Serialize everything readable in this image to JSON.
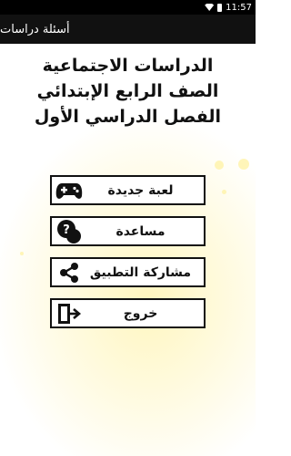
{
  "status_bar": {
    "time": "11:57",
    "icons": [
      "wifi-icon",
      "battery-icon"
    ]
  },
  "app_bar": {
    "title": "أسئلة دراسات"
  },
  "header": {
    "line1": "الدراسات الاجتماعية",
    "line2": "الصف الرابع الإبتدائي",
    "line3": "الفصل الدراسي الأول"
  },
  "menu": [
    {
      "label": "لعبة جديدة",
      "icon": "gamepad-icon"
    },
    {
      "label": "مساعدة",
      "icon": "help-icon"
    },
    {
      "label": "مشاركة التطبيق",
      "icon": "share-icon"
    },
    {
      "label": "خروج",
      "icon": "exit-icon"
    }
  ],
  "colors": {
    "accent_yellow": "#fff2a8",
    "text": "#111111",
    "app_bar": "#111111"
  }
}
